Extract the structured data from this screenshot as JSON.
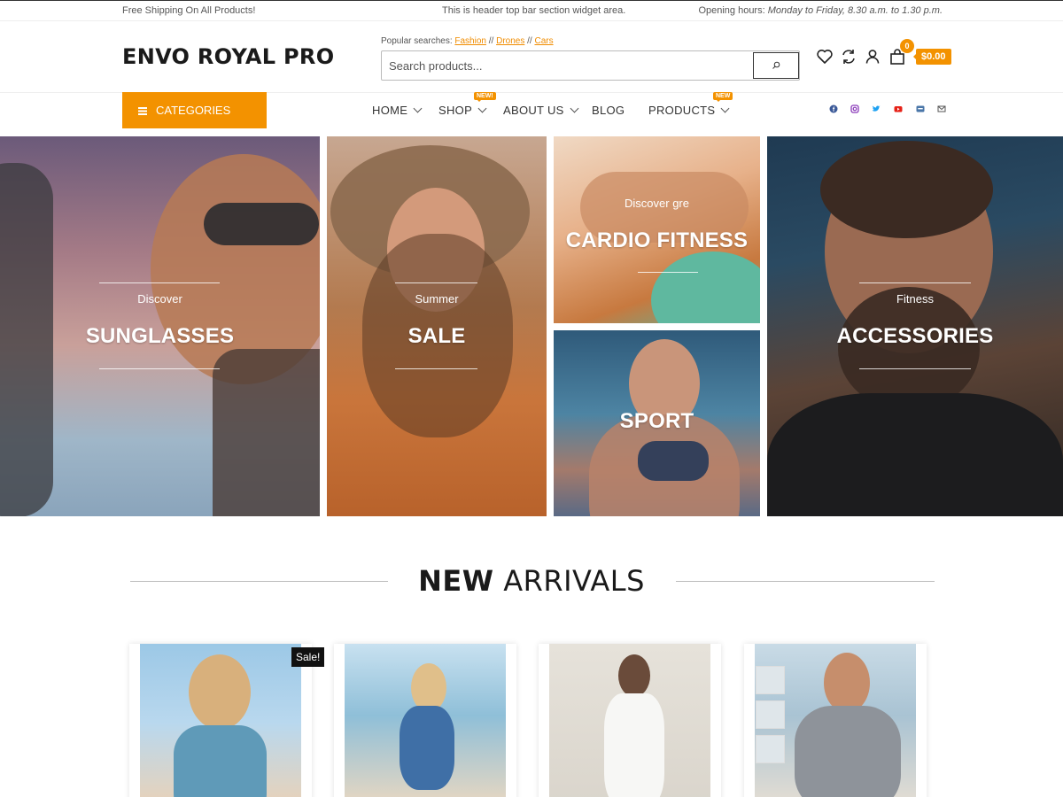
{
  "topbar": {
    "left": "Free Shipping On All Products!",
    "center": "This is header top bar section widget area.",
    "right_prefix": "Opening hours: ",
    "right_hours": "Monday to Friday, 8.30 a.m. to 1.30 p.m."
  },
  "header": {
    "logo": "ENVO ROYAL PRO",
    "popular_label": "Popular searches: ",
    "popular": [
      "Fashion",
      "Drones",
      "Cars"
    ],
    "search_placeholder": "Search products...",
    "cart_count": "0",
    "cart_total": "$0.00",
    "icons": [
      "heart-icon",
      "refresh-icon",
      "user-icon",
      "bag-icon"
    ]
  },
  "nav": {
    "categories": "CATEGORIES",
    "items": [
      {
        "label": "HOME",
        "dropdown": true
      },
      {
        "label": "SHOP",
        "dropdown": true,
        "badge": "NEW!"
      },
      {
        "label": "ABOUT US",
        "dropdown": true
      },
      {
        "label": "BLOG",
        "dropdown": false
      },
      {
        "label": "PRODUCTS",
        "dropdown": true,
        "badge": "NEW"
      }
    ],
    "social": [
      "facebook-icon",
      "instagram-icon",
      "twitter-icon",
      "youtube-icon",
      "vk-icon",
      "email-icon"
    ]
  },
  "hero": [
    {
      "sub": "Discover",
      "title": "SUNGLASSES"
    },
    {
      "sub": "Summer",
      "title": "SALE"
    },
    {
      "sub": "Discover gre",
      "title": "CARDIO FITNESS"
    },
    {
      "sub": "",
      "title": "SPORT"
    },
    {
      "sub": "Fitness",
      "title": "ACCESSORIES"
    }
  ],
  "section": {
    "bold": "NEW",
    "light": "ARRIVALS"
  },
  "products": {
    "sale_badge": "Sale!"
  },
  "colors": {
    "accent": "#f39200",
    "text": "#222222"
  }
}
